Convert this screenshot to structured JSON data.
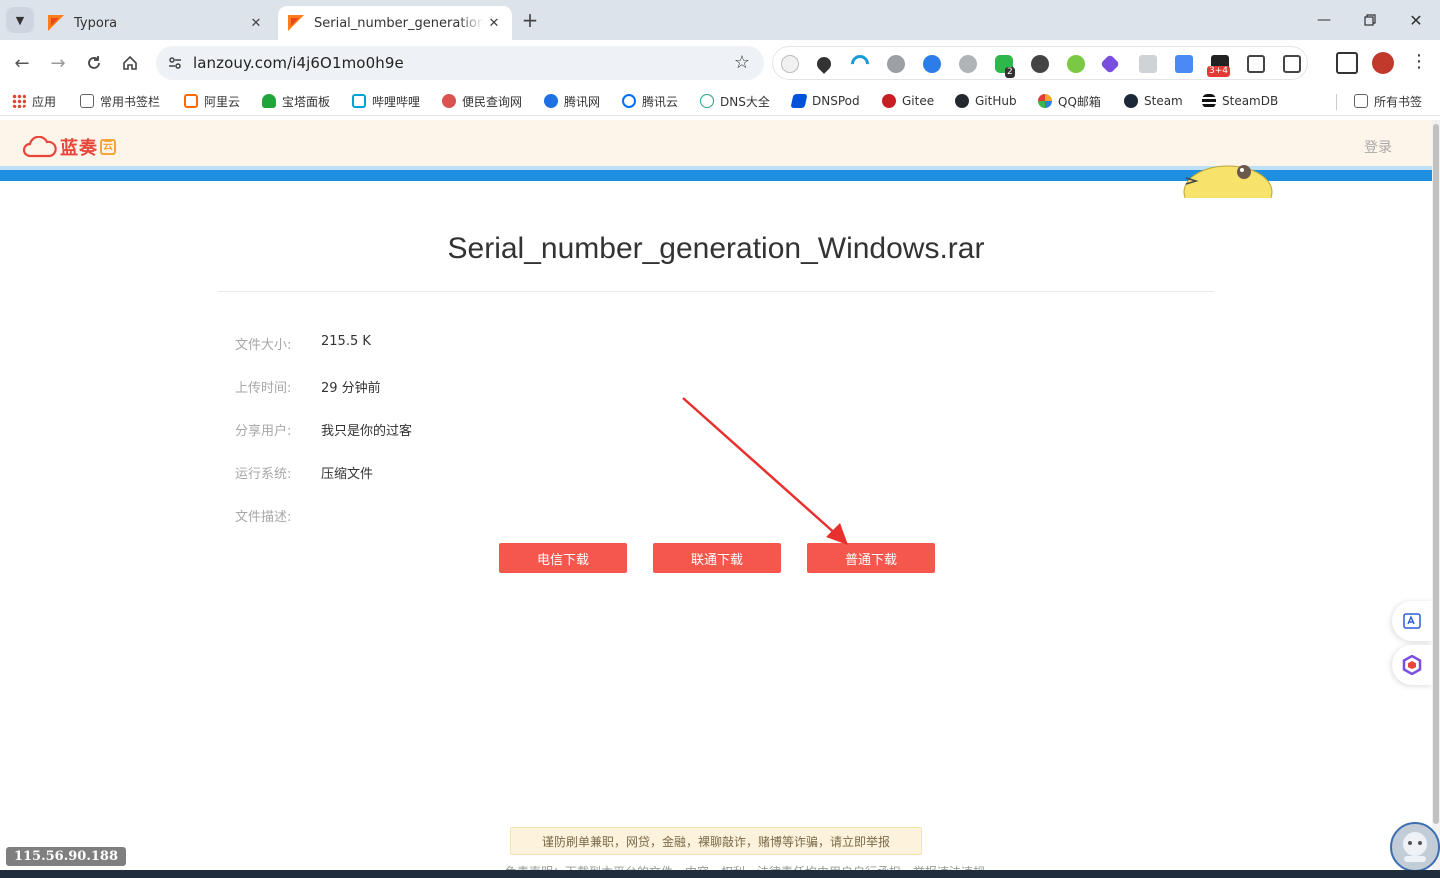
{
  "browser": {
    "tabs": [
      {
        "title": "Typora"
      },
      {
        "title": "Serial_number_generation_W"
      }
    ],
    "url": "lanzouy.com/i4j6O1mo0h9e",
    "ext_badges": {
      "wechat": "2",
      "tomato": "3+4"
    },
    "bookmarks": [
      {
        "label": "应用",
        "color": "#e3452f"
      },
      {
        "label": "常用书签栏",
        "color": "#5f6368"
      },
      {
        "label": "阿里云",
        "color": "#ff6a00"
      },
      {
        "label": "宝塔面板",
        "color": "#20a53a"
      },
      {
        "label": "哔哩哔哩",
        "color": "#00a1d6"
      },
      {
        "label": "便民查询网",
        "color": "#d9534f"
      },
      {
        "label": "腾讯网",
        "color": "#1f6fe5"
      },
      {
        "label": "腾讯云",
        "color": "#006eff"
      },
      {
        "label": "DNS大全",
        "color": "#2c9f8c"
      },
      {
        "label": "DNSPod",
        "color": "#0052d9"
      },
      {
        "label": "Gitee",
        "color": "#c71d23"
      },
      {
        "label": "GitHub",
        "color": "#24292f"
      },
      {
        "label": "QQ邮箱",
        "color": "#f5a623"
      },
      {
        "label": "Steam",
        "color": "#1b2838"
      },
      {
        "label": "SteamDB",
        "color": "#111111"
      }
    ],
    "all_bookmarks": "所有书签"
  },
  "site": {
    "logo_text": "蓝奏",
    "logo_box": "云",
    "login": "登录",
    "file_name": "Serial_number_generation_Windows.rar",
    "info": [
      {
        "label": "文件大小:",
        "value": "215.5 K"
      },
      {
        "label": "上传时间:",
        "value": "29 分钟前"
      },
      {
        "label": "分享用户:",
        "value": "我只是你的过客"
      },
      {
        "label": "运行系统:",
        "value": "压缩文件"
      },
      {
        "label": "文件描述:",
        "value": ""
      }
    ],
    "buttons": {
      "telecom": "电信下载",
      "unicom": "联通下载",
      "normal": "普通下载"
    },
    "warning": "谨防刷单兼职，网贷，金融，裸聊敲诈，赌博等诈骗，请立即举报",
    "footer_partial": "免责声明：下载到本平台的文件，内容、权利、法律责任均由用户自行承担，举报违法违规"
  },
  "overlay": {
    "ip": "115.56.90.188"
  },
  "colors": {
    "accent_red": "#f5574d",
    "header_bg": "#fdf4ea",
    "blue_bar": "#1e8ee0"
  }
}
